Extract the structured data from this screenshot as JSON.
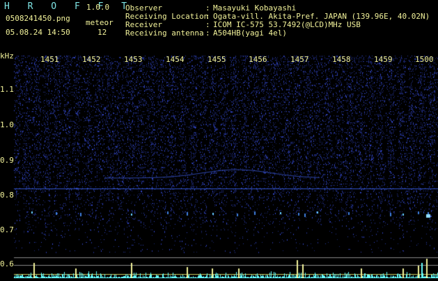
{
  "header": {
    "app_title": "H R O F F T",
    "version": "1.0.0",
    "filename": "0508241450.png",
    "meteor_label": "meteor",
    "meteor_count": "12",
    "datetime": "05.08.24 14:50",
    "fields": [
      {
        "label": "Observer",
        "sep": ":",
        "value": "Masayuki Kobayashi"
      },
      {
        "label": "Receiving Location",
        "sep": ":",
        "value": "Ogata-vill. Akita-Pref. JAPAN (139.96E, 40.02N)"
      },
      {
        "label": "Receiver",
        "sep": ":",
        "value": "ICOM IC-575 53.7492(@LCD)MHz USB"
      },
      {
        "label": "Receiving antenna",
        "sep": ":",
        "value": "A504HB(yagi 4el)"
      }
    ]
  },
  "spectrogram": {
    "y_unit": "kHz",
    "y_ticks": [
      "1.1",
      "1.0",
      "0.9",
      "0.8",
      "0.7",
      "0.6"
    ],
    "x_ticks": [
      "1451",
      "1452",
      "1453",
      "1454",
      "1455",
      "1456",
      "1457",
      "1458",
      "1459",
      "1500"
    ],
    "colors": {
      "background": "#000000",
      "noise": "#2a3a9a",
      "line": "#3355cc",
      "meter": "#66ffff",
      "grid_line": "#8a8a8a",
      "marker": "#f2f29a"
    }
  }
}
